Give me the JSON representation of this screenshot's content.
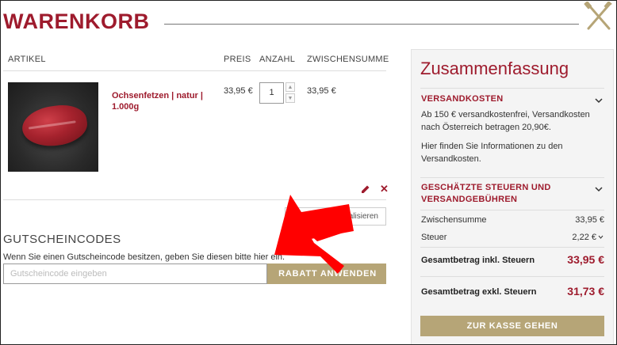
{
  "header": {
    "title": "WARENKORB",
    "logo_icon": "crossed-knife-fork-icon"
  },
  "table": {
    "headers": [
      "ARTIKEL",
      "PREIS",
      "ANZAHL",
      "ZWISCHENSUMME"
    ],
    "rows": [
      {
        "name": "Ochsenfetzen | natur | 1.000g",
        "price": "33,95 €",
        "quantity": "1",
        "subtotal": "33,95 €"
      }
    ]
  },
  "actions": {
    "update_cart_label": "Warenkorb aktualisieren"
  },
  "coupon": {
    "title": "GUTSCHEINCODES",
    "hint": "Wenn Sie einen Gutscheincode besitzen, geben Sie diesen bitte hier ein.",
    "placeholder": "Gutscheincode eingeben",
    "button": "RABATT ANWENDEN"
  },
  "summary": {
    "title": "Zusammenfassung",
    "shipping": {
      "heading": "VERSANDKOSTEN",
      "text": "Ab 150 € versandkostenfrei, Versandkosten nach Österreich betragen 20,90€.",
      "info": "Hier finden Sie Informationen zu den Versandkosten."
    },
    "tax": {
      "heading": "GESCHÄTZTE STEUERN UND VERSANDGEBÜHREN"
    },
    "rows": {
      "subtotal_label": "Zwischensumme",
      "subtotal_value": "33,95 €",
      "tax_label": "Steuer",
      "tax_value": "2,22 €"
    },
    "total_incl_label": "Gesamtbetrag inkl. Steuern",
    "total_incl_value": "33,95 €",
    "total_excl_label": "Gesamtbetrag exkl. Steuern",
    "total_excl_value": "31,73 €",
    "checkout_button": "ZUR KASSE GEHEN"
  },
  "colors": {
    "brand": "#9e1b2d",
    "accent": "#b6a577",
    "annotation_arrow": "#ff0000"
  }
}
